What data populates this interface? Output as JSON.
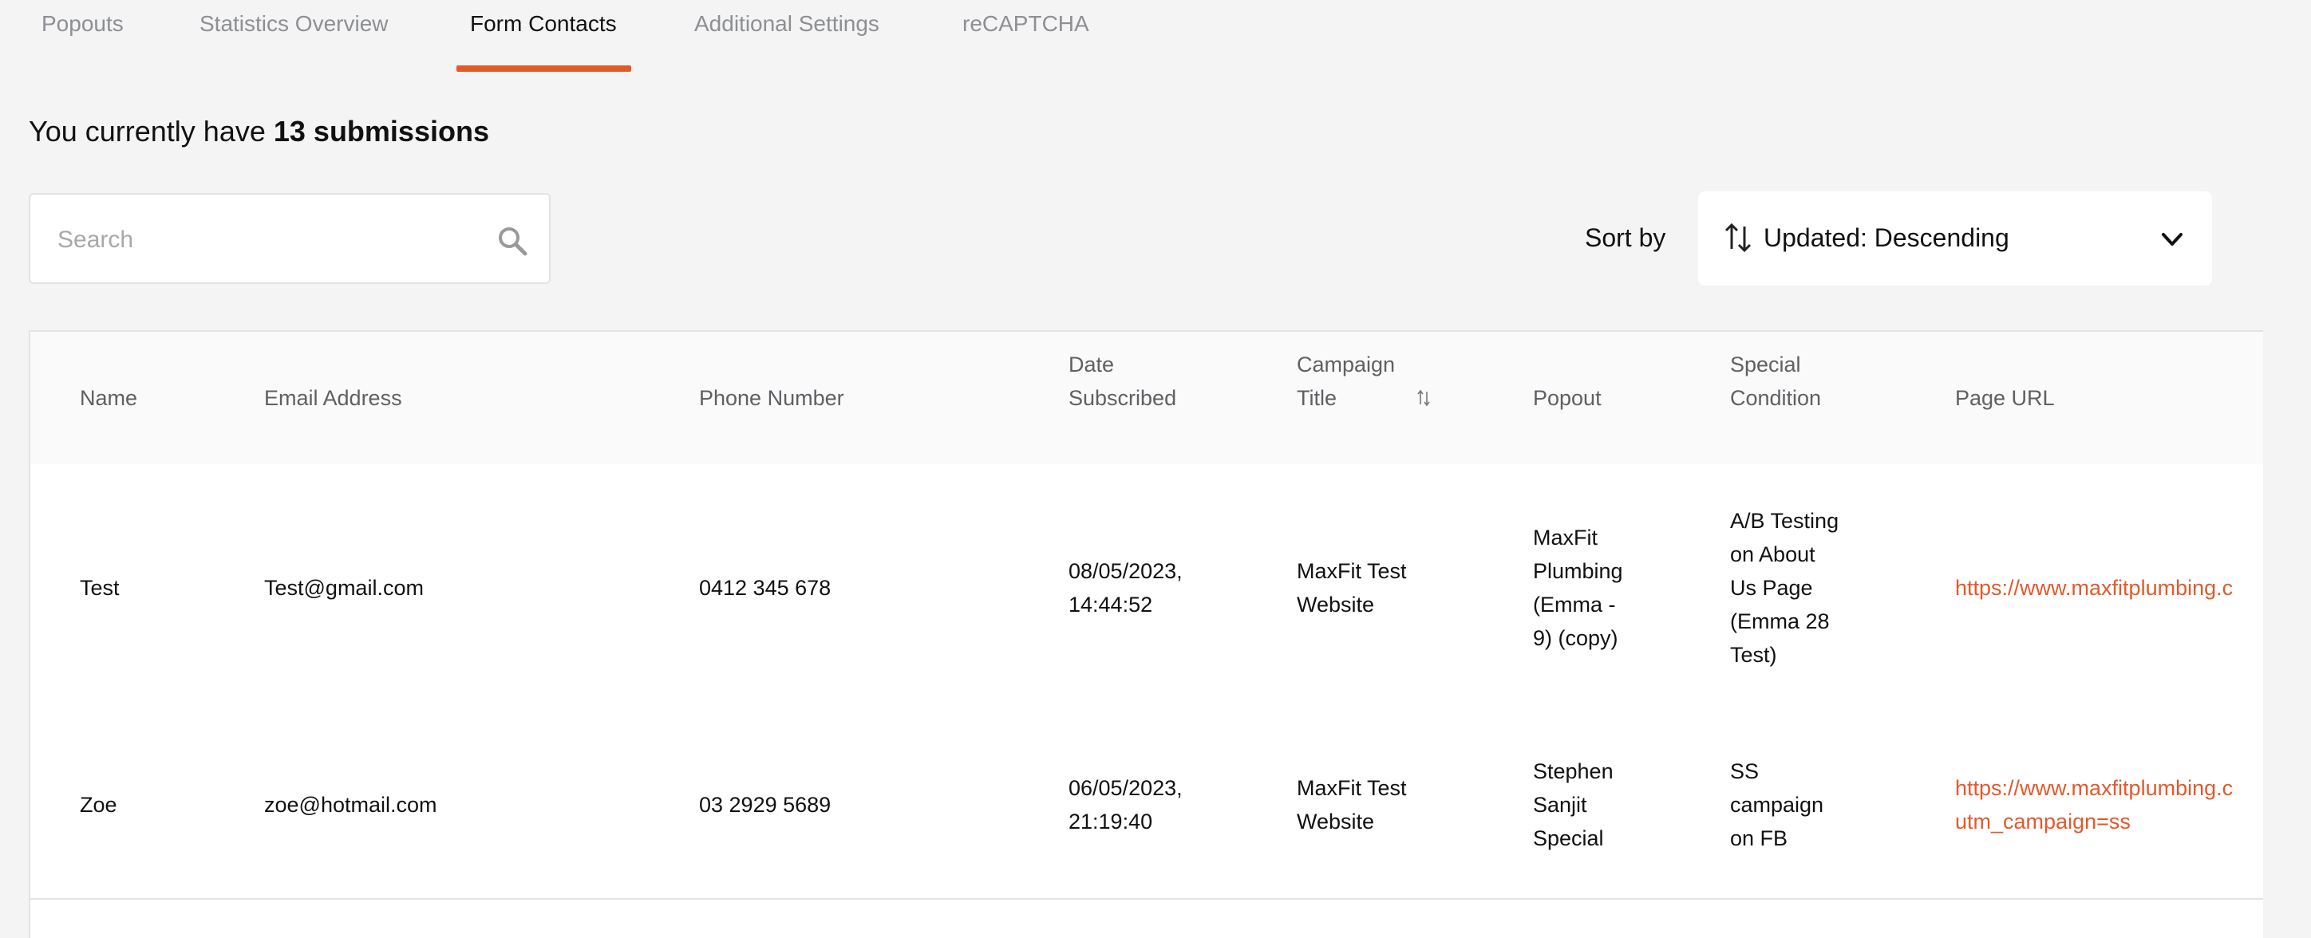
{
  "tabs": [
    {
      "label": "Popouts"
    },
    {
      "label": "Statistics Overview"
    },
    {
      "label": "Form Contacts"
    },
    {
      "label": "Additional Settings"
    },
    {
      "label": "reCAPTCHA"
    }
  ],
  "summary": {
    "prefix": "You currently have",
    "count_text": "13 submissions"
  },
  "search": {
    "placeholder": "Search",
    "value": ""
  },
  "sort": {
    "label": "Sort by",
    "value": "Updated: Descending"
  },
  "table": {
    "headers": {
      "name": "Name",
      "email": "Email Address",
      "phone": "Phone Number",
      "date_line1": "Date",
      "date_line2": "Subscribed",
      "campaign_line1": "Campaign",
      "campaign_line2": "Title",
      "popout": "Popout",
      "special_line1": "Special",
      "special_line2": "Condition",
      "url": "Page URL"
    },
    "rows": [
      {
        "name": "Test",
        "email": "Test@gmail.com",
        "phone": "0412 345 678",
        "date": [
          "08/05/2023,",
          "14:44:52"
        ],
        "campaign": [
          "MaxFit Test",
          "Website"
        ],
        "popout": [
          "MaxFit",
          "Plumbing",
          "(Emma -",
          "9) (copy)"
        ],
        "special": [
          "A/B Testing",
          "on About",
          "Us Page",
          "(Emma 28",
          "Test)"
        ],
        "url": [
          "https://www.maxfitplumbing.c"
        ]
      },
      {
        "name": "Zoe",
        "email": "zoe@hotmail.com",
        "phone": "03 2929 5689",
        "date": [
          "06/05/2023,",
          "21:19:40"
        ],
        "campaign": [
          "MaxFit Test",
          "Website"
        ],
        "popout": [
          "Stephen",
          "Sanjit",
          "Special"
        ],
        "special": [
          "SS",
          "campaign",
          "on FB"
        ],
        "url": [
          "https://www.maxfitplumbing.c",
          "utm_campaign=ss"
        ]
      }
    ]
  },
  "colors": {
    "accent": "#e4592a",
    "background": "#f4f4f4"
  }
}
